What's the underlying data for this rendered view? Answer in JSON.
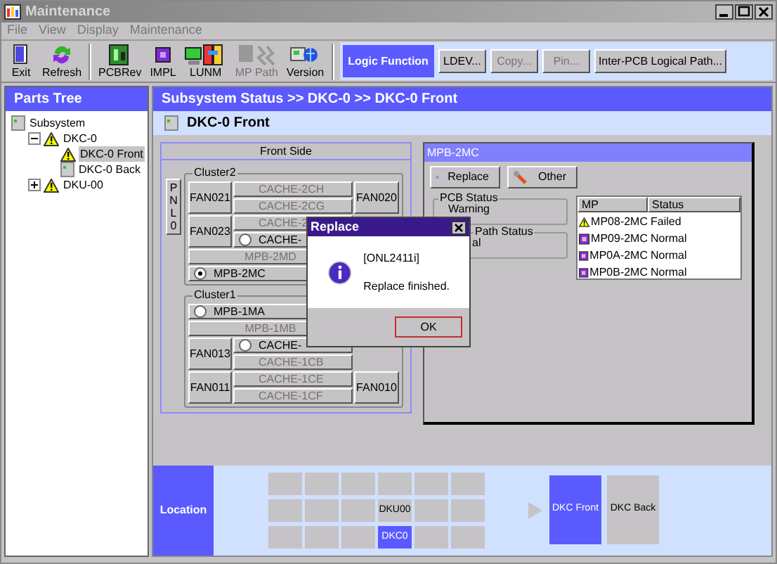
{
  "window": {
    "title": "Maintenance"
  },
  "menu": [
    "File",
    "View",
    "Display",
    "Maintenance"
  ],
  "toolbar": [
    {
      "label": "Exit",
      "disabled": false
    },
    {
      "label": "Refresh",
      "disabled": false
    },
    {
      "label": "PCBRev",
      "disabled": false
    },
    {
      "label": "IMPL",
      "disabled": false
    },
    {
      "label": "LUNM",
      "disabled": false
    },
    {
      "label": "MP Path",
      "disabled": true
    },
    {
      "label": "Version",
      "disabled": false
    }
  ],
  "logic_function": {
    "label": "Logic Function",
    "buttons": [
      {
        "label": "LDEV...",
        "disabled": false
      },
      {
        "label": "Copy...",
        "disabled": true
      },
      {
        "label": "Pin...",
        "disabled": true
      },
      {
        "label": "Inter-PCB Logical Path...",
        "disabled": false
      }
    ]
  },
  "parts_tree": {
    "title": "Parts Tree",
    "items": [
      {
        "label": "Subsystem",
        "warning": false,
        "selected": false,
        "children": [
          {
            "label": "DKC-0",
            "warning": true,
            "selected": false,
            "expanded": true,
            "children": [
              {
                "label": "DKC-0 Front",
                "warning": true,
                "selected": true
              },
              {
                "label": "DKC-0 Back",
                "warning": false,
                "selected": false
              }
            ]
          },
          {
            "label": "DKU-00",
            "warning": true,
            "selected": false,
            "expanded": false
          }
        ]
      }
    ]
  },
  "breadcrumb": "Subsystem Status >> DKC-0 >> DKC-0 Front",
  "page_title": "DKC-0 Front",
  "front_side": {
    "title": "Front Side",
    "panel": "PNL0",
    "clusters": [
      {
        "label": "Cluster2",
        "fans_left": [
          "FAN021",
          "FAN023"
        ],
        "fans_right": [
          "FAN020"
        ],
        "caches": [
          {
            "label": "CACHE-2CH",
            "disabled": true,
            "kind": "slot"
          },
          {
            "label": "CACHE-2CG",
            "disabled": true,
            "kind": "slot"
          },
          {
            "label": "CACHE-2",
            "disabled": true,
            "kind": "slot"
          },
          {
            "label": "CACHE-",
            "disabled": false,
            "kind": "radio",
            "selected": false
          }
        ],
        "mpbs": [
          {
            "label": "MPB-2MD",
            "disabled": true,
            "kind": "slot"
          },
          {
            "label": "MPB-2MC",
            "disabled": false,
            "kind": "radio",
            "selected": true
          }
        ]
      },
      {
        "label": "Cluster1",
        "fans_left": [
          "FAN013",
          "FAN011"
        ],
        "fans_right": [
          "FAN010"
        ],
        "caches": [
          {
            "label": "CACHE-",
            "disabled": false,
            "kind": "radio",
            "selected": false
          },
          {
            "label": "CACHE-1CB",
            "disabled": true,
            "kind": "slot"
          },
          {
            "label": "CACHE-1CE",
            "disabled": true,
            "kind": "slot"
          },
          {
            "label": "CACHE-1CF",
            "disabled": true,
            "kind": "slot"
          }
        ],
        "mpbs": [
          {
            "label": "MPB-1MA",
            "disabled": false,
            "kind": "radio",
            "selected": false
          },
          {
            "label": "MPB-1MB",
            "disabled": true,
            "kind": "slot"
          }
        ]
      }
    ]
  },
  "mpb_panel": {
    "title": "MPB-2MC",
    "buttons": [
      {
        "label": "Replace"
      },
      {
        "label": "Other"
      }
    ],
    "groups": [
      {
        "label": "PCB Status",
        "value": "Warning"
      },
      {
        "label": "Path Status",
        "value": "al"
      }
    ],
    "table": {
      "columns": [
        "MP",
        "Status"
      ],
      "rows": [
        {
          "mp": "MP08-2MC",
          "status": "Failed",
          "warning": true
        },
        {
          "mp": "MP09-2MC",
          "status": "Normal",
          "warning": false
        },
        {
          "mp": "MP0A-2MC",
          "status": "Normal",
          "warning": false
        },
        {
          "mp": "MP0B-2MC",
          "status": "Normal",
          "warning": false
        }
      ]
    }
  },
  "dialog": {
    "title": "Replace",
    "code": "[ONL2411i]",
    "message": "Replace finished.",
    "button": "OK"
  },
  "location": {
    "label": "Location",
    "cells": [
      {
        "selected": false
      },
      {
        "selected": false
      },
      {
        "selected": false
      },
      {
        "selected": false
      },
      {
        "selected": false
      },
      {
        "selected": false
      },
      {
        "selected": false
      },
      {
        "selected": false
      },
      {
        "selected": false
      },
      {
        "label": "DKU00",
        "selected": false
      },
      {
        "selected": false
      },
      {
        "selected": false
      },
      {
        "selected": false
      },
      {
        "selected": false
      },
      {
        "selected": false
      },
      {
        "label": "DKC0",
        "selected": true
      },
      {
        "selected": false
      },
      {
        "selected": false
      }
    ],
    "views": [
      {
        "label": "DKC Front",
        "selected": true
      },
      {
        "label": "DKC Back",
        "selected": false
      }
    ]
  }
}
